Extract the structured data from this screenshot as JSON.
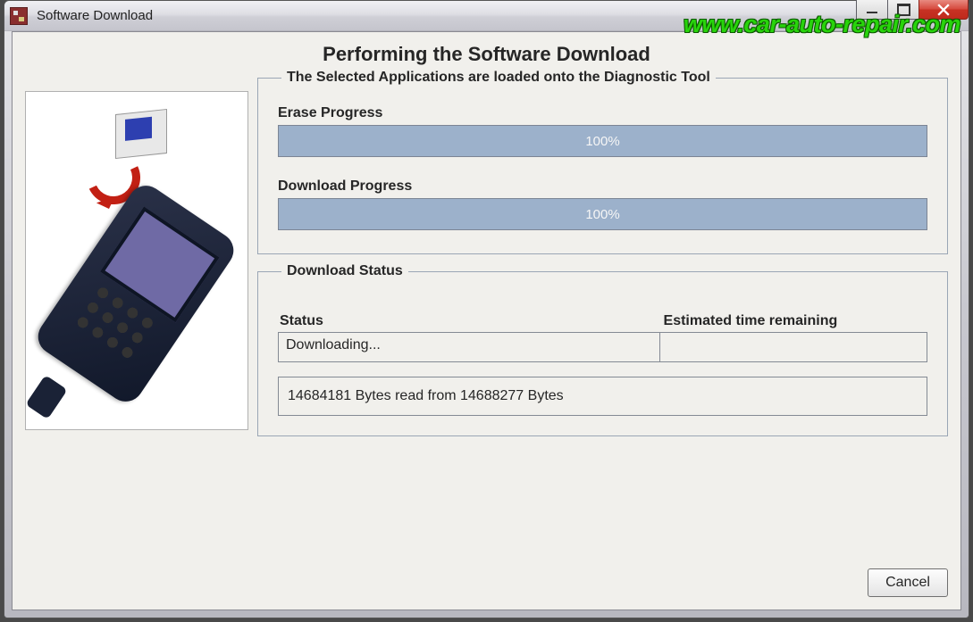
{
  "window": {
    "title": "Software Download"
  },
  "page": {
    "heading": "Performing the Software Download"
  },
  "groupbox_apps": {
    "legend": "The Selected Applications are loaded onto the Diagnostic Tool",
    "erase": {
      "label": "Erase Progress",
      "value": "100%"
    },
    "download": {
      "label": "Download Progress",
      "value": "100%"
    }
  },
  "groupbox_status": {
    "legend": "Download Status",
    "columns": {
      "status": "Status",
      "time": "Estimated time remaining"
    },
    "row": {
      "status": "Downloading...",
      "time": ""
    },
    "bytes": "14684181 Bytes read from 14688277 Bytes"
  },
  "buttons": {
    "cancel": "Cancel"
  },
  "watermark": "www.car-auto-repair.com"
}
